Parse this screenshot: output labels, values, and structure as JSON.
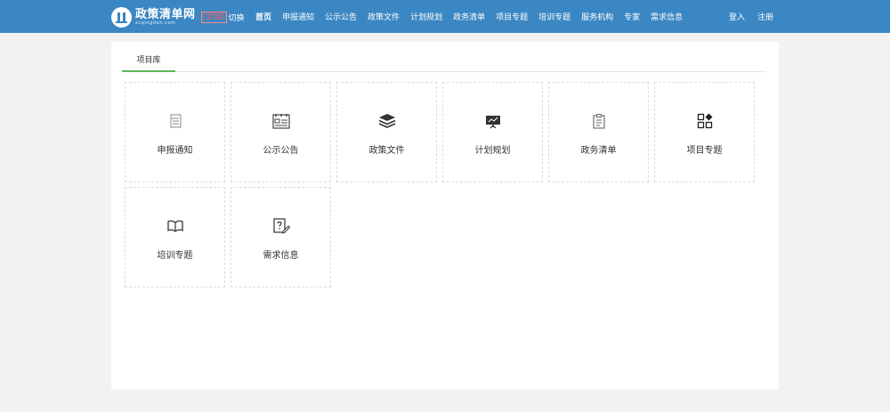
{
  "header": {
    "brand_name": "政策清单网",
    "brand_domain": "zcqingdan.com",
    "region_tag": "[全国]",
    "region_switch": "切换",
    "nav": [
      "首页",
      "申报通知",
      "公示公告",
      "政策文件",
      "计划规划",
      "政务清单",
      "项目专题",
      "培训专题",
      "服务机构",
      "专家",
      "需求信息"
    ],
    "active_nav": "首页",
    "login": "登入",
    "register": "注册"
  },
  "tabs": [
    {
      "label": "项目库",
      "active": true
    }
  ],
  "cards": [
    {
      "label": "申报通知",
      "icon": "document-list-icon"
    },
    {
      "label": "公示公告",
      "icon": "notice-board-icon"
    },
    {
      "label": "政策文件",
      "icon": "stack-layers-icon"
    },
    {
      "label": "计划规划",
      "icon": "presentation-chart-icon"
    },
    {
      "label": "政务清单",
      "icon": "clipboard-icon"
    },
    {
      "label": "项目专题",
      "icon": "grid-shapes-icon"
    },
    {
      "label": "培训专题",
      "icon": "open-book-icon"
    },
    {
      "label": "需求信息",
      "icon": "question-edit-icon"
    }
  ],
  "colors": {
    "header_bg": "#3a87c3",
    "tab_underline": "#5cb85c",
    "page_bg": "#f2f2f2"
  }
}
